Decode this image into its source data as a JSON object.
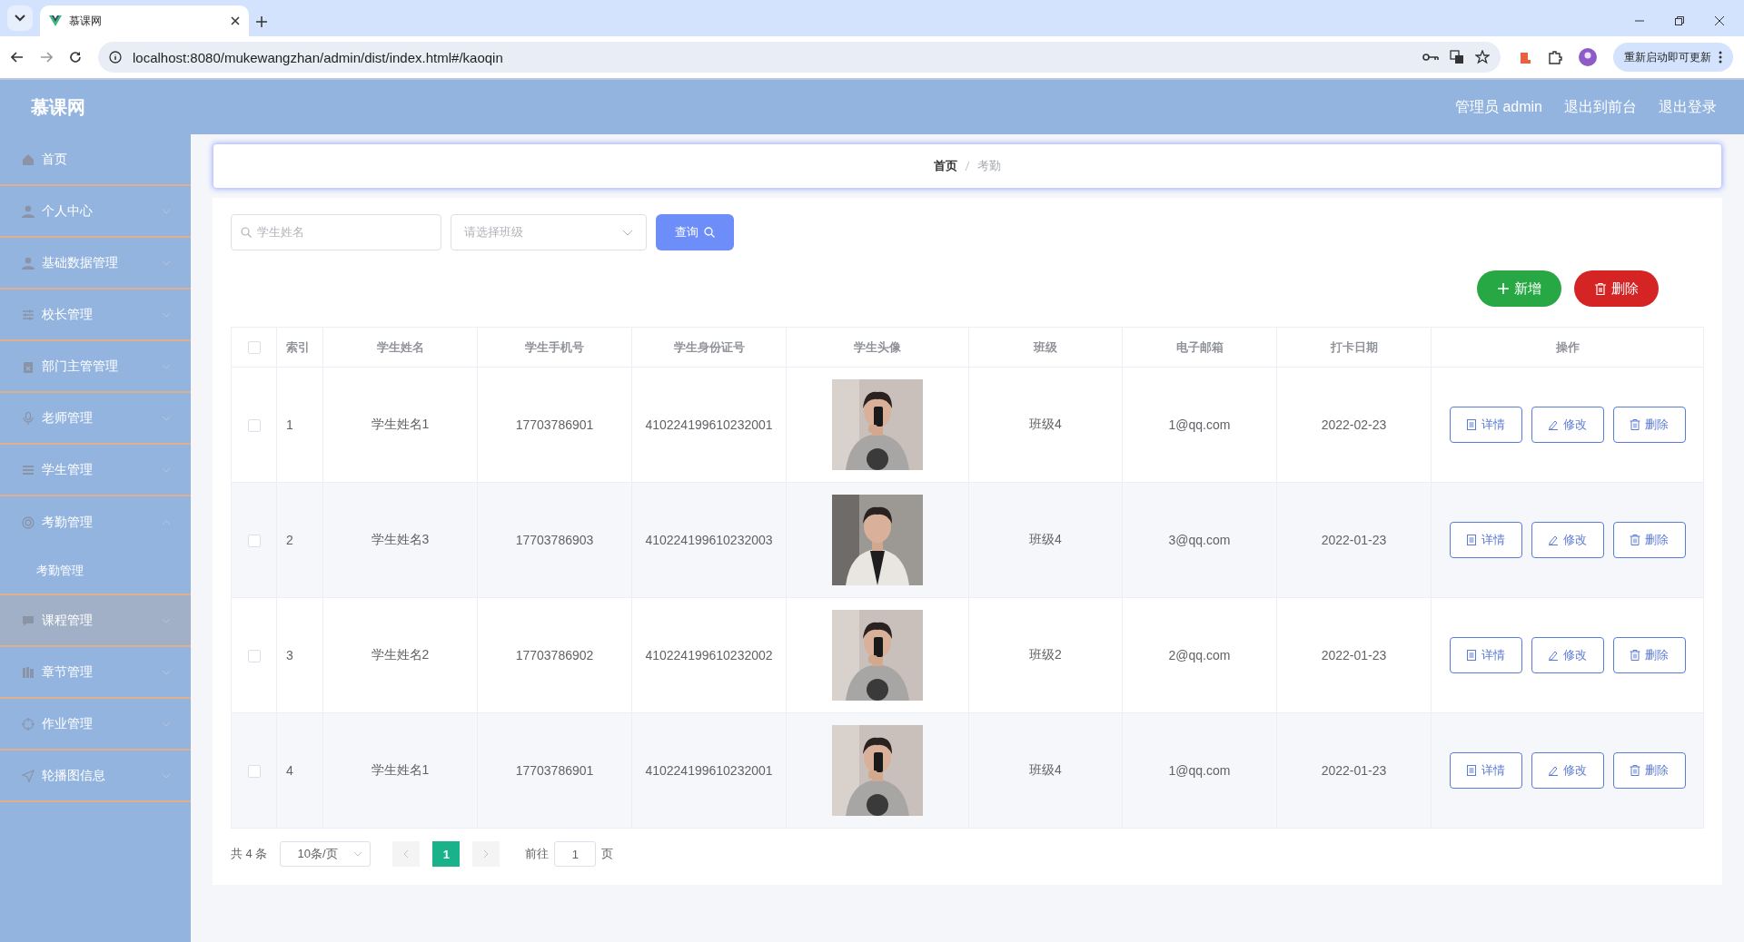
{
  "browser": {
    "tab_title": "慕课网",
    "url": "localhost:8080/mukewangzhan/admin/dist/index.html#/kaoqin",
    "update_button": "重新启动即可更新"
  },
  "header": {
    "logo": "慕课网",
    "user": "管理员 admin",
    "links": [
      "退出到前台",
      "退出登录"
    ]
  },
  "sidebar": {
    "items": [
      {
        "label": "首页",
        "kind": "link",
        "selected": false
      },
      {
        "label": "个人中心",
        "kind": "submenu",
        "expanded": false,
        "selected": false
      },
      {
        "label": "基础数据管理",
        "kind": "submenu",
        "expanded": false,
        "selected": false
      },
      {
        "label": "校长管理",
        "kind": "submenu",
        "expanded": false,
        "selected": false
      },
      {
        "label": "部门主管管理",
        "kind": "submenu",
        "expanded": false,
        "selected": false
      },
      {
        "label": "老师管理",
        "kind": "submenu",
        "expanded": false,
        "selected": false
      },
      {
        "label": "学生管理",
        "kind": "submenu",
        "expanded": false,
        "selected": false
      },
      {
        "label": "考勤管理",
        "kind": "submenu",
        "expanded": true,
        "selected": false,
        "children": [
          {
            "label": "考勤管理",
            "selected": false
          }
        ]
      },
      {
        "label": "课程管理",
        "kind": "submenu",
        "expanded": false,
        "selected": true
      },
      {
        "label": "章节管理",
        "kind": "submenu",
        "expanded": false,
        "selected": false
      },
      {
        "label": "作业管理",
        "kind": "submenu",
        "expanded": false,
        "selected": false
      },
      {
        "label": "轮播图信息",
        "kind": "submenu",
        "expanded": false,
        "selected": false
      }
    ]
  },
  "breadcrumb": [
    "首页",
    "考勤"
  ],
  "search": {
    "name_placeholder": "学生姓名",
    "class_placeholder": "请选择班级",
    "query_button": "查询"
  },
  "actions": {
    "add": "新增",
    "delete": "删除"
  },
  "table": {
    "select_all_checked": false,
    "columns": [
      "索引",
      "学生姓名",
      "学生手机号",
      "学生身份证号",
      "学生头像",
      "班级",
      "电子邮箱",
      "打卡日期",
      "操作"
    ],
    "rows": [
      {
        "checked": false,
        "index": "1",
        "name": "学生姓名1",
        "phone": "17703786901",
        "id_number": "410224199610232001",
        "photo": {
          "kind": "picture"
        },
        "class": "班级4",
        "email": "1@qq.com",
        "date": "2022-02-23",
        "buttons": [
          "详情",
          "修改",
          "删除"
        ]
      },
      {
        "checked": false,
        "index": "2",
        "name": "学生姓名3",
        "phone": "17703786903",
        "id_number": "410224199610232003",
        "photo": {
          "kind": "picture"
        },
        "class": "班级4",
        "email": "3@qq.com",
        "date": "2022-01-23",
        "buttons": [
          "详情",
          "修改",
          "删除"
        ]
      },
      {
        "checked": false,
        "index": "3",
        "name": "学生姓名2",
        "phone": "17703786902",
        "id_number": "410224199610232002",
        "photo": {
          "kind": "picture"
        },
        "class": "班级2",
        "email": "2@qq.com",
        "date": "2022-01-23",
        "buttons": [
          "详情",
          "修改",
          "删除"
        ]
      },
      {
        "checked": false,
        "index": "4",
        "name": "学生姓名1",
        "phone": "17703786901",
        "id_number": "410224199610232001",
        "photo": {
          "kind": "picture"
        },
        "class": "班级4",
        "email": "1@qq.com",
        "date": "2022-01-23",
        "buttons": [
          "详情",
          "修改",
          "删除"
        ]
      }
    ]
  },
  "pagination": {
    "total": "共 4 条",
    "page_size": "10条/页",
    "pages": [
      {
        "label": "1",
        "selected": true
      }
    ],
    "goto_label": "前往",
    "goto_value": "1",
    "goto_suffix": "页"
  }
}
